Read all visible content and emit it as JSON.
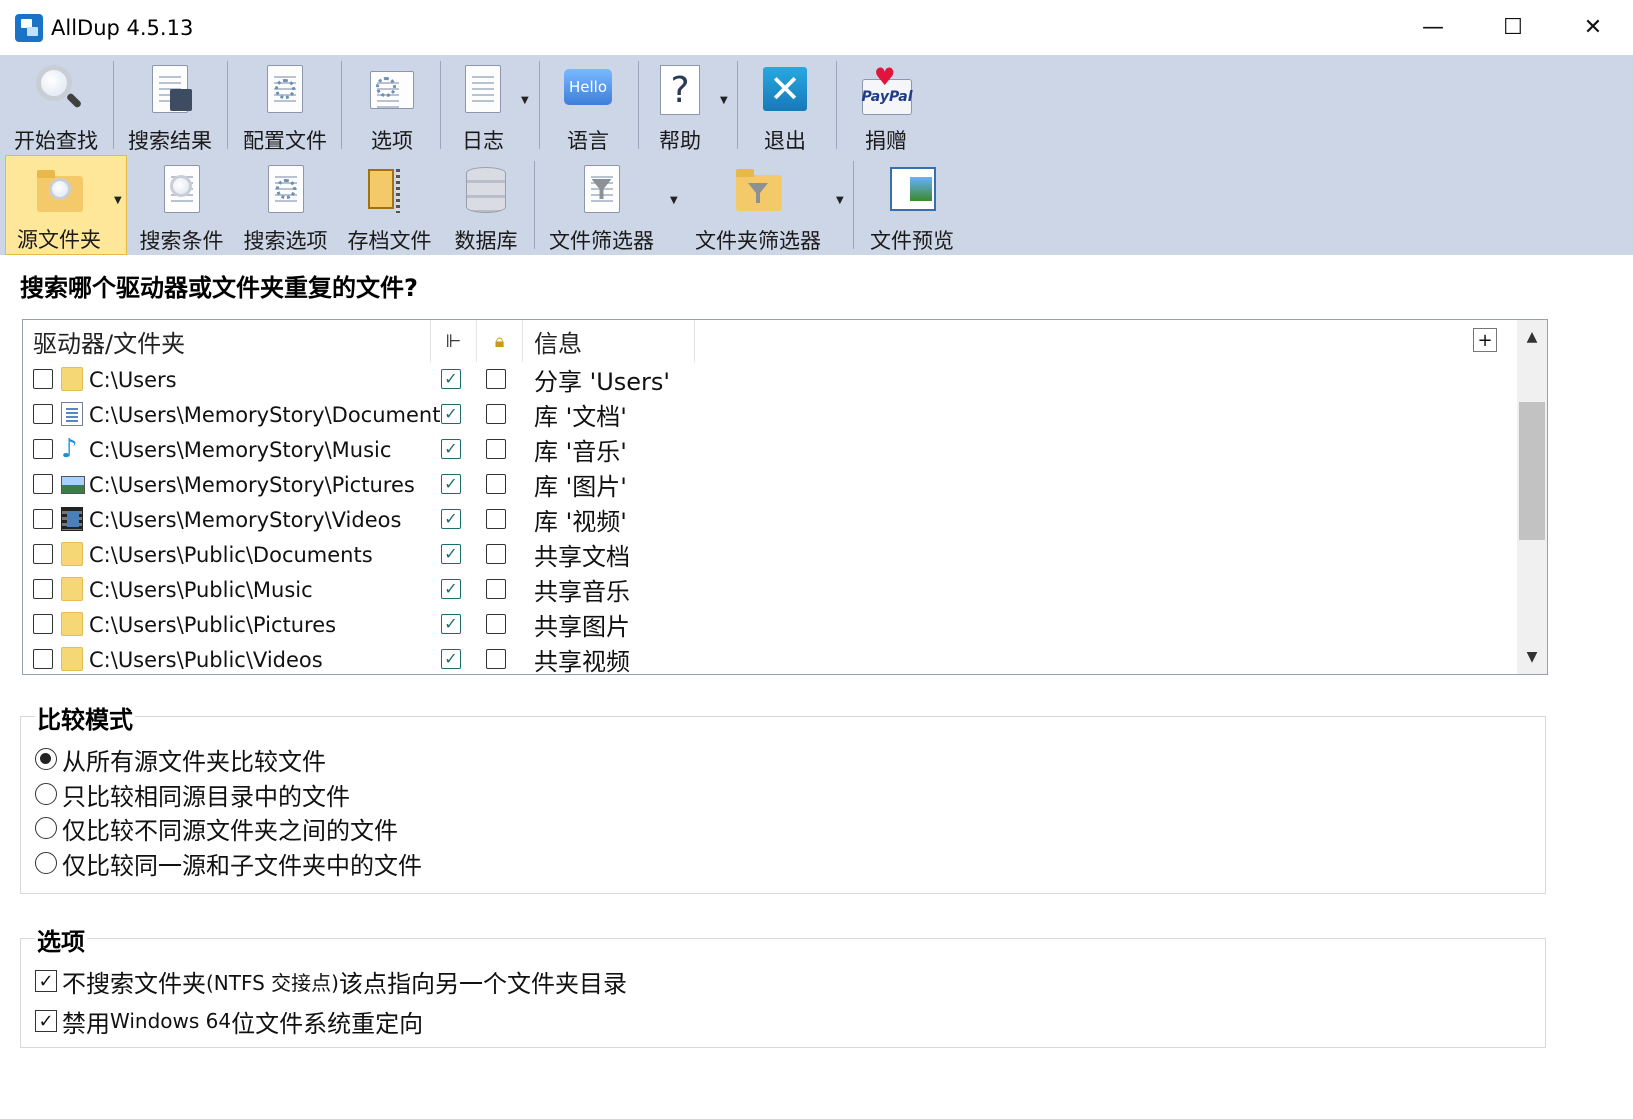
{
  "window": {
    "title": "AllDup 4.5.13",
    "minimize": "—",
    "maximize": "☐",
    "close": "✕"
  },
  "toolbar_top": [
    {
      "label": "开始查找",
      "icon": "magnifier-icon"
    },
    {
      "label": "搜索结果",
      "icon": "search-results-icon"
    },
    {
      "label": "配置文件",
      "icon": "profile-icon"
    },
    {
      "label": "选项",
      "icon": "options-icon"
    },
    {
      "label": "日志",
      "icon": "log-icon"
    },
    {
      "label": "语言",
      "icon": "hello-language-icon",
      "icon_text": "Hello"
    },
    {
      "label": "帮助",
      "icon": "help-icon",
      "icon_text": "?"
    },
    {
      "label": "退出",
      "icon": "exit-icon",
      "icon_text": "✕"
    },
    {
      "label": "捐赠",
      "icon": "paypal-icon",
      "icon_text": "PayPal"
    }
  ],
  "toolbar_bottom": [
    {
      "label": "源文件夹",
      "icon": "source-folder-icon",
      "active": true
    },
    {
      "label": "搜索条件",
      "icon": "search-criteria-icon"
    },
    {
      "label": "搜索选项",
      "icon": "search-options-icon"
    },
    {
      "label": "存档文件",
      "icon": "archive-icon"
    },
    {
      "label": "数据库",
      "icon": "database-icon"
    },
    {
      "label": "文件筛选器",
      "icon": "file-filter-icon"
    },
    {
      "label": "文件夹筛选器",
      "icon": "folder-filter-icon"
    },
    {
      "label": "文件预览",
      "icon": "file-preview-icon"
    }
  ],
  "main": {
    "question": "搜索哪个驱动器或文件夹重复的文件?",
    "columns": {
      "path": "驱动器/文件夹",
      "info": "信息"
    },
    "rows": [
      {
        "path": "C:\\Users",
        "info": "分享 'Users'",
        "icon": "folder",
        "subfolders": true,
        "protected": false
      },
      {
        "path": "C:\\Users\\MemoryStory\\Documents",
        "info": "库 '文档'",
        "icon": "document",
        "subfolders": true,
        "protected": false
      },
      {
        "path": "C:\\Users\\MemoryStory\\Music",
        "info": "库 '音乐'",
        "icon": "music",
        "subfolders": true,
        "protected": false
      },
      {
        "path": "C:\\Users\\MemoryStory\\Pictures",
        "info": "库 '图片'",
        "icon": "picture",
        "subfolders": true,
        "protected": false
      },
      {
        "path": "C:\\Users\\MemoryStory\\Videos",
        "info": "库 '视频'",
        "icon": "video",
        "subfolders": true,
        "protected": false
      },
      {
        "path": "C:\\Users\\Public\\Documents",
        "info": "共享文档",
        "icon": "folder",
        "subfolders": true,
        "protected": false
      },
      {
        "path": "C:\\Users\\Public\\Music",
        "info": "共享音乐",
        "icon": "folder",
        "subfolders": true,
        "protected": false
      },
      {
        "path": "C:\\Users\\Public\\Pictures",
        "info": "共享图片",
        "icon": "folder",
        "subfolders": true,
        "protected": false
      },
      {
        "path": "C:\\Users\\Public\\Videos",
        "info": "共享视频",
        "icon": "folder",
        "subfolders": true,
        "protected": false
      }
    ]
  },
  "compare_mode": {
    "title": "比较模式",
    "options": [
      {
        "label": "从所有源文件夹比较文件",
        "selected": true
      },
      {
        "label": "只比较相同源目录中的文件",
        "selected": false
      },
      {
        "label": "仅比较不同源文件夹之间的文件",
        "selected": false
      },
      {
        "label": "仅比较同一源和子文件夹中的文件",
        "selected": false
      }
    ]
  },
  "options": {
    "title": "选项",
    "items": [
      {
        "pre": "不搜索文件夹 ",
        "small": "(NTFS 交接点)",
        "post": " 该点指向另一个文件夹目录",
        "checked": true
      },
      {
        "pre": "禁用 ",
        "small": "Windows 64",
        "post": " 位文件系统重定向",
        "checked": true
      }
    ]
  }
}
